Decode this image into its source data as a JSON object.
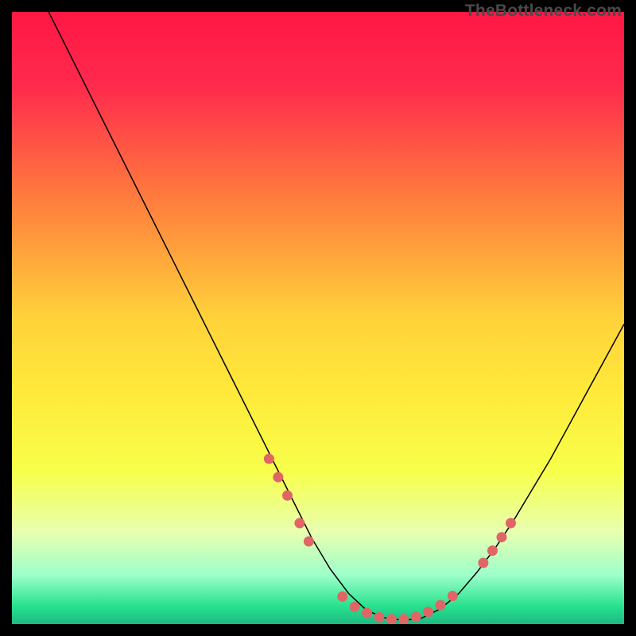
{
  "watermark": "TheBottleneck.com",
  "chart_data": {
    "type": "line",
    "title": "",
    "xlabel": "",
    "ylabel": "",
    "xlim": [
      0,
      100
    ],
    "ylim": [
      0,
      100
    ],
    "background_gradient": {
      "stops": [
        {
          "offset": 0,
          "color": "#ff1744"
        },
        {
          "offset": 12,
          "color": "#ff2a4d"
        },
        {
          "offset": 30,
          "color": "#ff7a3d"
        },
        {
          "offset": 50,
          "color": "#ffd23a"
        },
        {
          "offset": 62,
          "color": "#ffe93a"
        },
        {
          "offset": 75,
          "color": "#f7ff4a"
        },
        {
          "offset": 85,
          "color": "#e8ffb0"
        },
        {
          "offset": 92,
          "color": "#9dffca"
        },
        {
          "offset": 97,
          "color": "#28e28f"
        },
        {
          "offset": 100,
          "color": "#1db981"
        }
      ]
    },
    "series": [
      {
        "name": "bottleneck-curve",
        "stroke": "#000000",
        "stroke_width": 1.5,
        "x": [
          6,
          8,
          10,
          13,
          16,
          20,
          24,
          28,
          32,
          36,
          40,
          43,
          46,
          49,
          52,
          55,
          58,
          61,
          64,
          67,
          70,
          73,
          76,
          79,
          82,
          85,
          88,
          91,
          94,
          97,
          100
        ],
        "y": [
          100,
          96,
          92,
          86,
          80,
          72,
          64,
          56,
          48,
          40,
          32,
          26,
          20,
          14,
          9,
          5,
          2.2,
          1,
          0.6,
          1,
          2.5,
          5,
          8.5,
          12.5,
          17,
          22,
          27,
          32.5,
          38,
          43.5,
          49
        ]
      }
    ],
    "markers": {
      "name": "highlight-dots",
      "color": "#e06666",
      "radius": 6.5,
      "points": [
        {
          "x": 42,
          "y": 27
        },
        {
          "x": 43.5,
          "y": 24
        },
        {
          "x": 45,
          "y": 21
        },
        {
          "x": 47,
          "y": 16.5
        },
        {
          "x": 48.5,
          "y": 13.5
        },
        {
          "x": 54,
          "y": 4.5
        },
        {
          "x": 56,
          "y": 2.8
        },
        {
          "x": 58,
          "y": 1.8
        },
        {
          "x": 60,
          "y": 1.1
        },
        {
          "x": 62,
          "y": 0.8
        },
        {
          "x": 64,
          "y": 0.8
        },
        {
          "x": 66,
          "y": 1.2
        },
        {
          "x": 68,
          "y": 2
        },
        {
          "x": 70,
          "y": 3.1
        },
        {
          "x": 72,
          "y": 4.6
        },
        {
          "x": 77,
          "y": 10
        },
        {
          "x": 78.5,
          "y": 12
        },
        {
          "x": 80,
          "y": 14.2
        },
        {
          "x": 81.5,
          "y": 16.5
        }
      ]
    }
  }
}
